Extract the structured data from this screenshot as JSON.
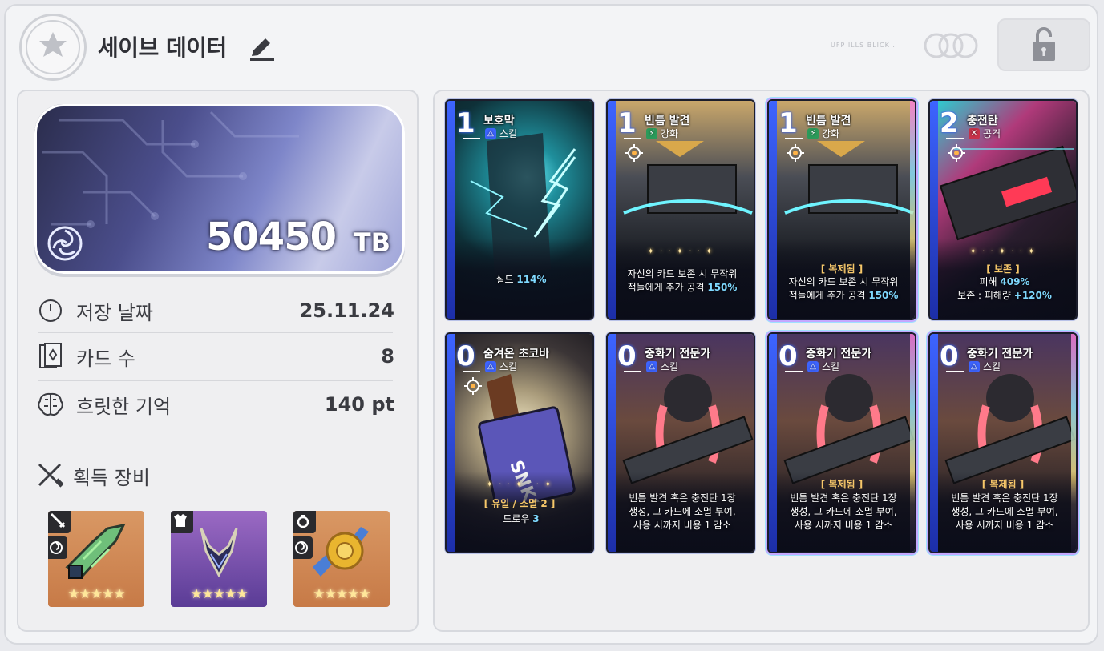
{
  "header": {
    "title": "세이브 데이터",
    "small_text": "UFP ILLS BLICK .",
    "logo_icon": "star-emblem-icon",
    "edit_icon": "pencil-icon",
    "lock_icon": "lock-icon"
  },
  "save": {
    "amount": "50450",
    "unit": "TB",
    "stats": [
      {
        "icon": "clock-icon",
        "label": "저장 날짜",
        "value": "25.11.24"
      },
      {
        "icon": "cards-icon",
        "label": "카드 수",
        "value": "8"
      },
      {
        "icon": "brain-icon",
        "label": "흐릿한 기억",
        "value": "140 pt"
      }
    ],
    "equipment_title": "획득 장비",
    "equipment": [
      {
        "type": "weapon",
        "stars": "★★★★★",
        "color": "orange"
      },
      {
        "type": "armor",
        "stars": "★★★★★",
        "color": "purple"
      },
      {
        "type": "accessory",
        "stars": "★★★★★",
        "color": "orange"
      }
    ]
  },
  "cards": [
    {
      "cost": "1",
      "name": "보호막",
      "type": "스킬",
      "type_icon": "skill-icon",
      "tag": "",
      "desc_pre": "실드 ",
      "desc_hl": "114%",
      "desc_post": "",
      "line2": ""
    },
    {
      "cost": "1",
      "name": "빈틈 발견",
      "type": "강화",
      "type_icon": "enhance-icon",
      "tag": "",
      "desc_pre": "자신의 카드 보존 시 무작위",
      "desc_hl": "",
      "desc_post": "",
      "line2_pre": "적들에게 추가 공격 ",
      "line2_hl": "150%"
    },
    {
      "cost": "1",
      "name": "빈틈 발견",
      "type": "강화",
      "type_icon": "enhance-icon",
      "tag": "[ 복제됨 ]",
      "desc_pre": "자신의 카드 보존 시 무작위",
      "desc_hl": "",
      "desc_post": "",
      "line2_pre": "적들에게 추가 공격 ",
      "line2_hl": "150%"
    },
    {
      "cost": "2",
      "name": "충전탄",
      "type": "공격",
      "type_icon": "attack-icon",
      "tag": "[ 보존 ]",
      "desc_pre": "피해 ",
      "desc_hl": "409%",
      "desc_post": "",
      "line2_pre": "보존 : 피해량 ",
      "line2_hl": "+120%"
    },
    {
      "cost": "0",
      "name": "숨겨온 초코바",
      "type": "스킬",
      "type_icon": "skill-icon",
      "tag": "[ 유일 / 소멸 2 ]",
      "desc_pre": "드로우 ",
      "desc_hl": "3",
      "desc_post": "",
      "line2": ""
    },
    {
      "cost": "0",
      "name": "중화기 전문가",
      "type": "스킬",
      "type_icon": "skill-icon",
      "tag": "",
      "desc_lines": [
        "빈틈 발견 혹은 충전탄 1장",
        "생성, 그 카드에 소멸 부여,",
        "사용 시까지 비용 1 감소"
      ]
    },
    {
      "cost": "0",
      "name": "중화기 전문가",
      "type": "스킬",
      "type_icon": "skill-icon",
      "tag": "[ 복제됨 ]",
      "desc_lines": [
        "빈틈 발견 혹은 충전탄 1장",
        "생성, 그 카드에 소멸 부여,",
        "사용 시까지 비용 1 감소"
      ]
    },
    {
      "cost": "0",
      "name": "중화기 전문가",
      "type": "스킬",
      "type_icon": "skill-icon",
      "tag": "[ 복제됨 ]",
      "desc_lines": [
        "빈틈 발견 혹은 충전탄 1장",
        "생성, 그 카드에 소멸 부여,",
        "사용 시까지 비용 1 감소"
      ]
    }
  ],
  "colors": {
    "accent_blue": "#3d64ff",
    "highlight": "#7fd9ff",
    "tag_gold": "#f7c86a"
  }
}
